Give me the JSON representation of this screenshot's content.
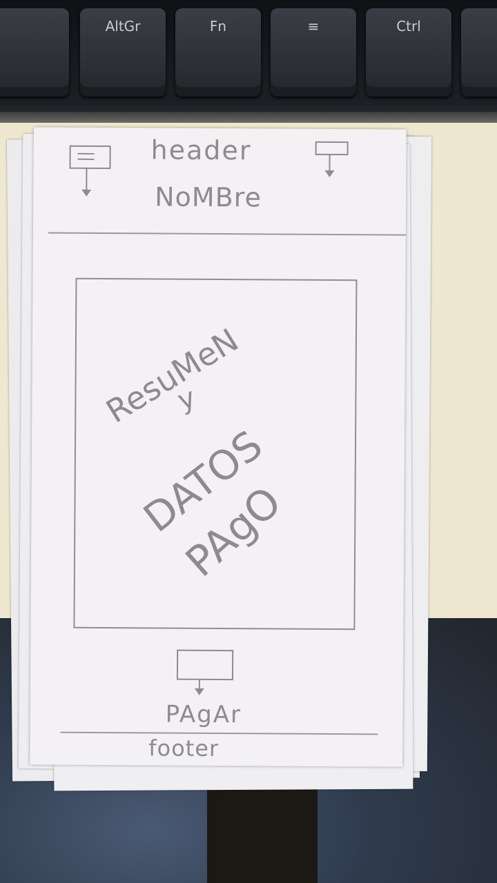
{
  "keyboard": {
    "keys": [
      "AltGr",
      "Fn",
      "≡",
      "Ctrl"
    ]
  },
  "wireframe": {
    "header": {
      "title": "header",
      "name": "NoMBre",
      "left_icon": "menu-icon",
      "right_icon": "cart-icon"
    },
    "content": {
      "line1": "ResuMeN",
      "line2": "y",
      "line3": "DATOS",
      "line4": "PAgO"
    },
    "pay_button": {
      "label": "PAgAr"
    },
    "footer": {
      "label": "footer"
    }
  }
}
